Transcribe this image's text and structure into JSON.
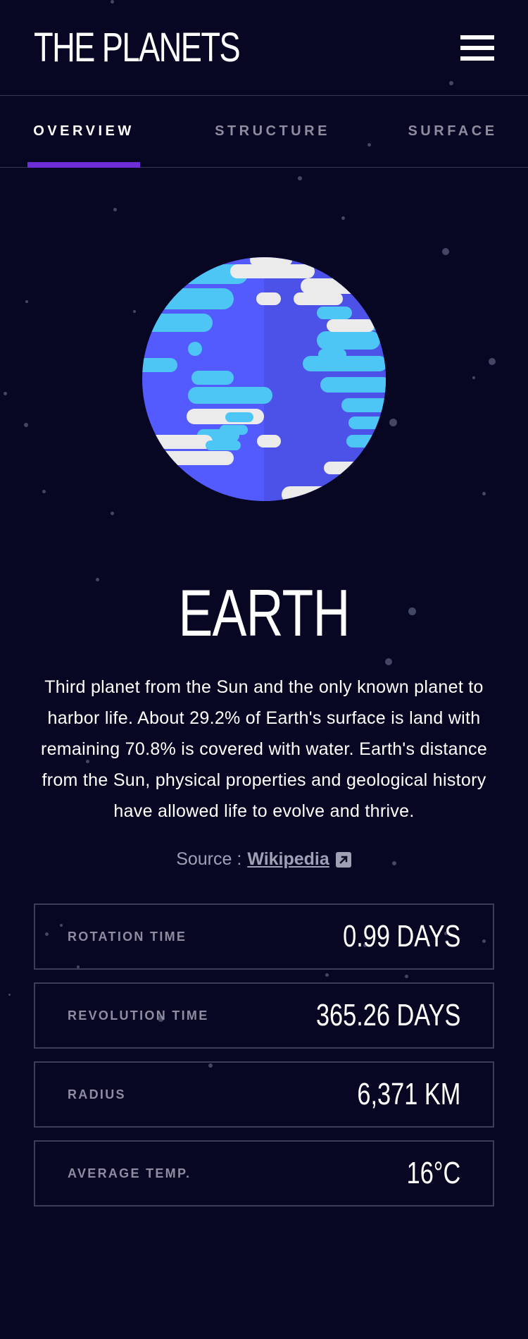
{
  "header": {
    "title": "THE PLANETS",
    "menu_icon": "hamburger-icon"
  },
  "tabs": [
    {
      "label": "OVERVIEW",
      "active": true
    },
    {
      "label": "STRUCTURE",
      "active": false
    },
    {
      "label": "SURFACE",
      "active": false
    }
  ],
  "planet": {
    "name": "EARTH",
    "image": "earth-planet-illustration",
    "description": "Third planet from the Sun and the only known planet to harbor life. About 29.2% of Earth's surface is land with remaining 70.8% is covered with water. Earth's distance from the Sun, physical properties and geological history have allowed life to evolve and thrive.",
    "source_label": "Source :",
    "source_link": "Wikipedia",
    "source_icon": "external-link-icon"
  },
  "stats": [
    {
      "label": "ROTATION TIME",
      "value": "0.99 DAYS"
    },
    {
      "label": "REVOLUTION TIME",
      "value": "365.26 DAYS"
    },
    {
      "label": "RADIUS",
      "value": "6,371 KM"
    },
    {
      "label": "AVERAGE TEMP.",
      "value": "16°C"
    }
  ],
  "colors": {
    "background": "#070724",
    "accent": "#6d2ed5",
    "border": "#38384f",
    "muted_text": "#8d8d9f",
    "planet_primary": "#545bfe",
    "planet_ocean": "#4ec6f5"
  }
}
